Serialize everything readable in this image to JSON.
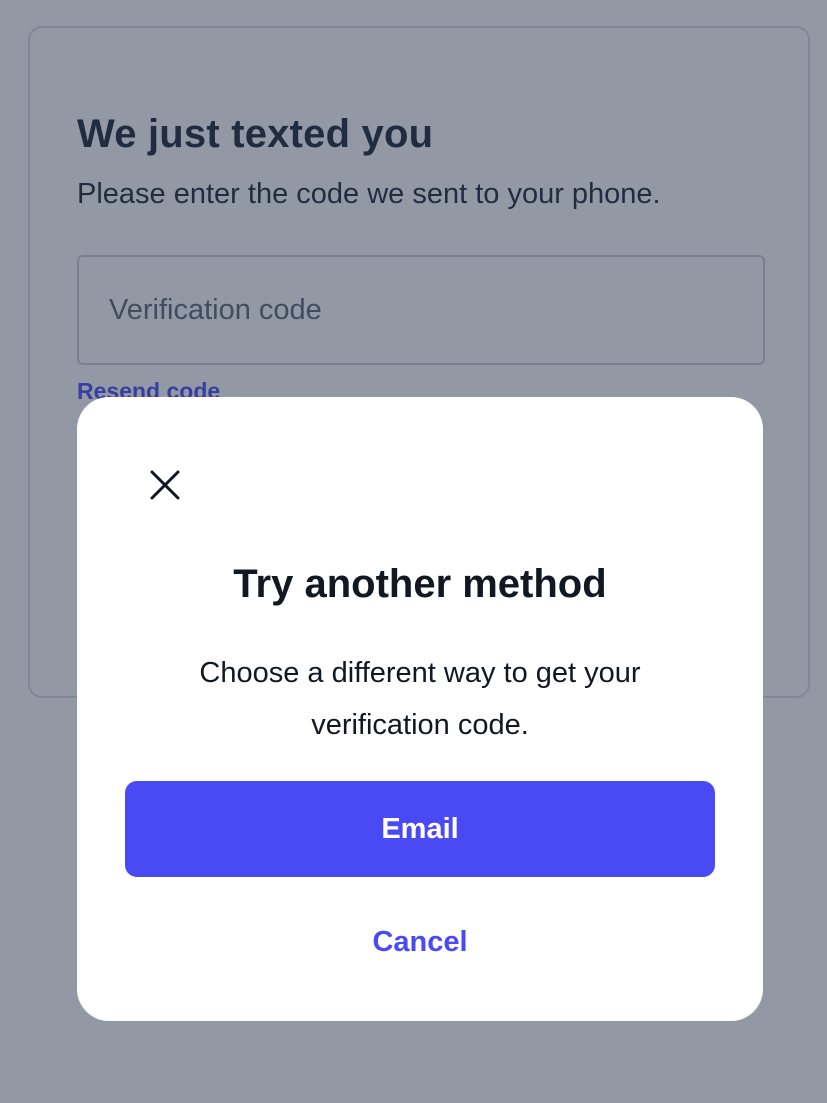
{
  "page": {
    "title": "We just texted you",
    "subtitle": "Please enter the code we sent to your phone.",
    "code_input": {
      "placeholder": "Verification code",
      "value": ""
    },
    "resend_label": "Resend code"
  },
  "modal": {
    "close_icon": "close-icon",
    "title": "Try another method",
    "description": "Choose a different way to get your verification code.",
    "email_label": "Email",
    "cancel_label": "Cancel"
  },
  "colors": {
    "accent": "#4a4af4",
    "text": "#111822",
    "overlay": "rgba(37, 51, 76, 0.5)"
  }
}
